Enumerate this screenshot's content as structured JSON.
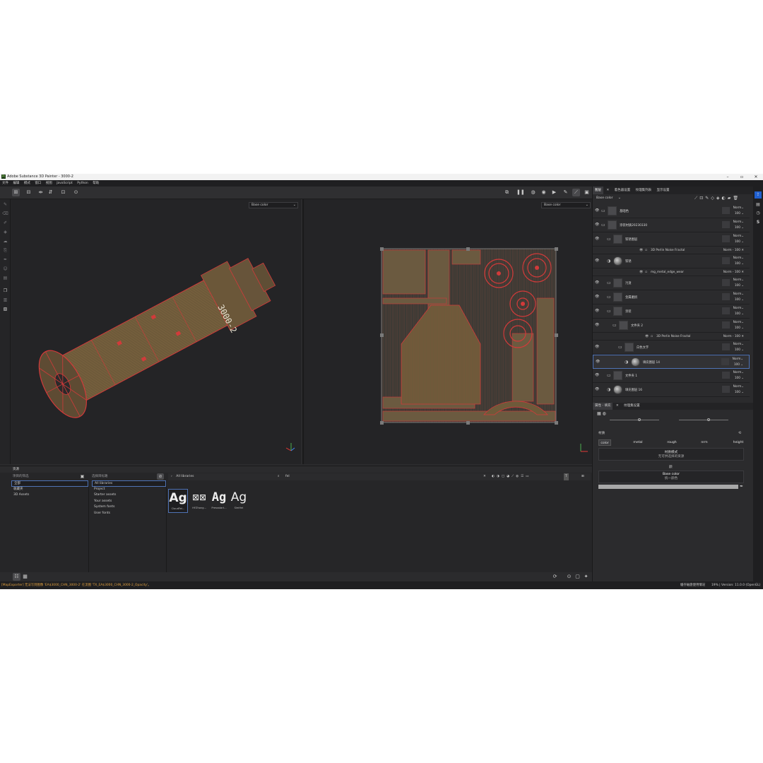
{
  "window": {
    "title": "Adobe Substance 3D Painter - 3000-2"
  },
  "menu": [
    "文件",
    "编辑",
    "模式",
    "窗口",
    "视图",
    "JavaScript",
    "Python",
    "帮助"
  ],
  "viewports": {
    "left_channel": "Base color",
    "right_channel": "Base color",
    "mesh_text": "3000-2"
  },
  "right_tabs": [
    "图层",
    "着色器设置",
    "纹理集列表",
    "显示设置"
  ],
  "layer_channel": "Base color",
  "layers": [
    {
      "name": "基础色",
      "blend": "Norm",
      "opacity": "100",
      "indent": 0,
      "type": "folder"
    },
    {
      "name": "涂装材质20230330",
      "blend": "Norm",
      "opacity": "100",
      "indent": 0,
      "type": "folder"
    },
    {
      "name": "铁锈图层",
      "blend": "Norm",
      "opacity": "100",
      "indent": 1,
      "type": "folder"
    },
    {
      "name": "3D Perlin Noise Fractal",
      "blend": "Norm",
      "opacity": "100",
      "indent": 2,
      "type": "fx"
    },
    {
      "name": "铁锈",
      "blend": "Norm",
      "opacity": "100",
      "indent": 1,
      "type": "fill"
    },
    {
      "name": "mg_metal_edge_wear",
      "blend": "Norm",
      "opacity": "100",
      "indent": 2,
      "type": "fx"
    },
    {
      "name": "污渍",
      "blend": "Norm",
      "opacity": "100",
      "indent": 1,
      "type": "folder"
    },
    {
      "name": "金属磨损",
      "blend": "Norm",
      "opacity": "100",
      "indent": 1,
      "type": "folder"
    },
    {
      "name": "涂装",
      "blend": "Norm",
      "opacity": "100",
      "indent": 1,
      "type": "folder"
    },
    {
      "name": "文件夹 2",
      "blend": "Norm",
      "opacity": "100",
      "indent": 2,
      "type": "folder"
    },
    {
      "name": "3D Perlin Noise Fractal",
      "blend": "Norm",
      "opacity": "100",
      "indent": 3,
      "type": "fx"
    },
    {
      "name": "白色文字",
      "blend": "Norm",
      "opacity": "100",
      "indent": 3,
      "type": "folder"
    },
    {
      "name": "填充图层 14",
      "blend": "Norm",
      "opacity": "100",
      "indent": 4,
      "type": "fill",
      "selected": true
    },
    {
      "name": "文件夹 1",
      "blend": "Norm",
      "opacity": "100",
      "indent": 1,
      "type": "folder"
    },
    {
      "name": "填充图层 16",
      "blend": "Norm",
      "opacity": "100",
      "indent": 1,
      "type": "fill"
    }
  ],
  "props": {
    "tabs": [
      "属性 - 填充",
      "纹理集设置"
    ],
    "section": "材质",
    "channels": [
      "color",
      "metal",
      "rough",
      "nrm",
      "height"
    ],
    "mode_title": "材质模式",
    "mode_value": "无可供选择的资源",
    "base_label": "颜",
    "base_color_title": "Base color",
    "base_color_value": "统一颜色"
  },
  "bottom": {
    "title": "资源",
    "col1_header": "项目的筛选",
    "col1_items": [
      "全部",
      "收藏夹",
      "3D Assets"
    ],
    "col2_header": "选择目标路",
    "col2_items": [
      "All libraries",
      "Project",
      "Starter assets",
      "Your assets",
      "System fonts",
      "User fonts"
    ],
    "breadcrumb": "All libraries",
    "search_value": "fel",
    "fonts": [
      {
        "glyph": "Ag",
        "name": "CloudFei..."
      },
      {
        "glyph": "⊠⊠",
        "name": "HYZhong..."
      },
      {
        "glyph": "Ag",
        "name": "Pressstart..."
      },
      {
        "glyph": "Ag",
        "name": "SimHei"
      }
    ]
  },
  "status": {
    "left": "[MapExporter] 无法写到图像 'EA$3000_CHN_3000-2' 在流图 'TX_EA$3000_CHN_3000-2_Opacity'。",
    "middle": "缓存磁盘使用情况",
    "right": "19% | Version: 11.0.0 (OpenGL)"
  },
  "colors": {
    "accent": "#4f73b5",
    "wire": "#d23a3a",
    "mesh": "#6e5a3a",
    "orange": "#e0822a"
  }
}
